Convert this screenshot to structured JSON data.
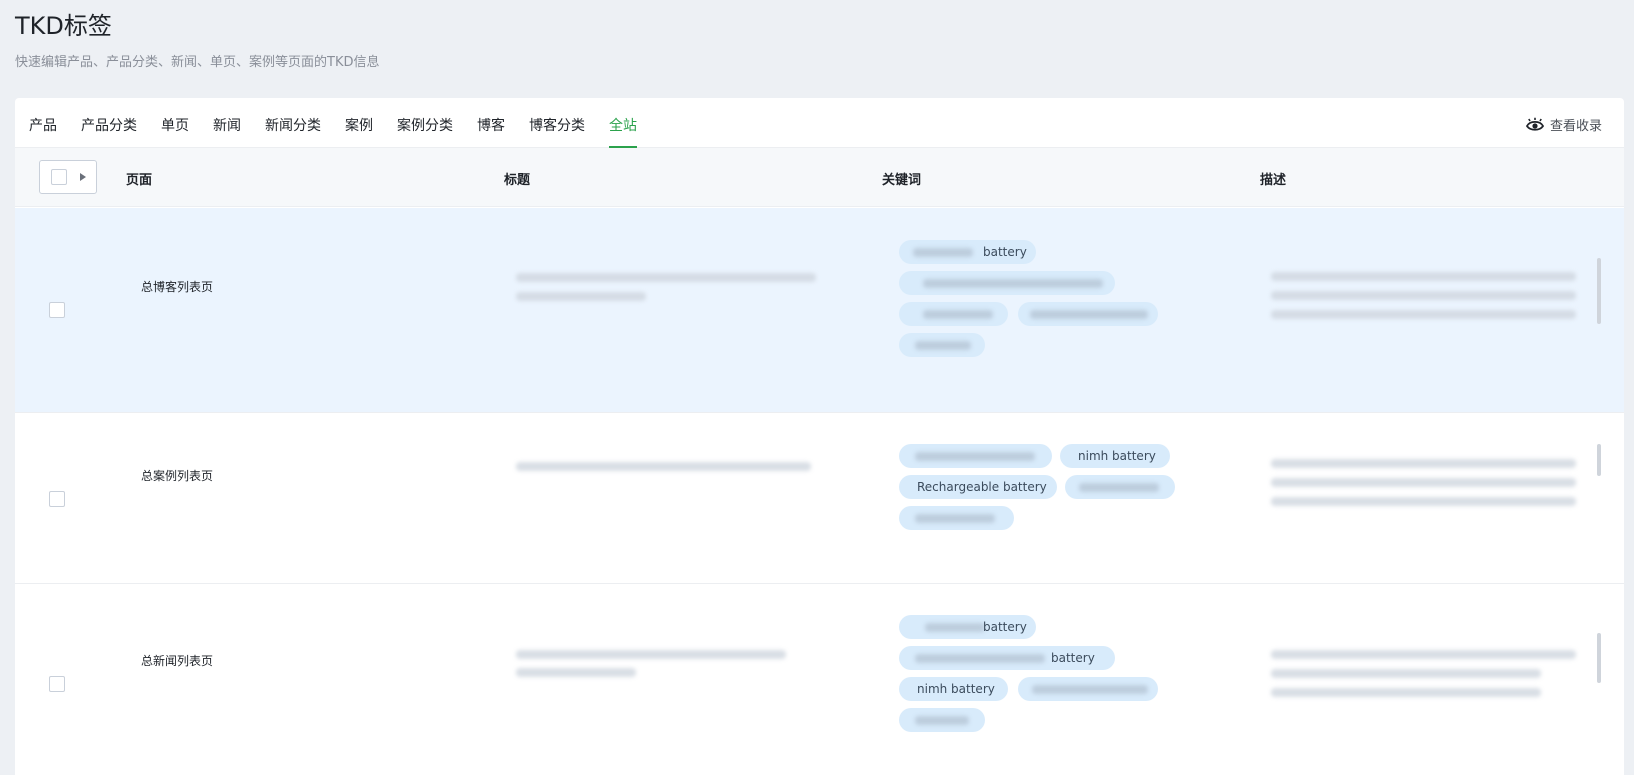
{
  "header": {
    "title": "TKD标签",
    "subtitle": "快速编辑产品、产品分类、新闻、单页、案例等页面的TKD信息"
  },
  "tabs": [
    {
      "label": "产品",
      "active": false
    },
    {
      "label": "产品分类",
      "active": false
    },
    {
      "label": "单页",
      "active": false
    },
    {
      "label": "新闻",
      "active": false
    },
    {
      "label": "新闻分类",
      "active": false
    },
    {
      "label": "案例",
      "active": false
    },
    {
      "label": "案例分类",
      "active": false
    },
    {
      "label": "博客",
      "active": false
    },
    {
      "label": "博客分类",
      "active": false
    },
    {
      "label": "全站",
      "active": true
    }
  ],
  "view_index_label": "查看收录",
  "table": {
    "columns": [
      "页面",
      "标题",
      "关键词",
      "描述"
    ],
    "rows": [
      {
        "page": "总博客列表页",
        "highlighted": true,
        "keywords": [
          "battery",
          "",
          "",
          "",
          ""
        ]
      },
      {
        "page": "总案例列表页",
        "highlighted": false,
        "keywords": [
          "",
          "nimh battery",
          "Rechargeable battery",
          "",
          ""
        ]
      },
      {
        "page": "总新闻列表页",
        "highlighted": false,
        "keywords": [
          "battery",
          "battery",
          "nimh battery",
          "",
          ""
        ]
      }
    ]
  },
  "colors": {
    "accent": "#2ba24c",
    "row_highlight": "#ebf4fe",
    "tag_bg": "#d8ebfb"
  }
}
